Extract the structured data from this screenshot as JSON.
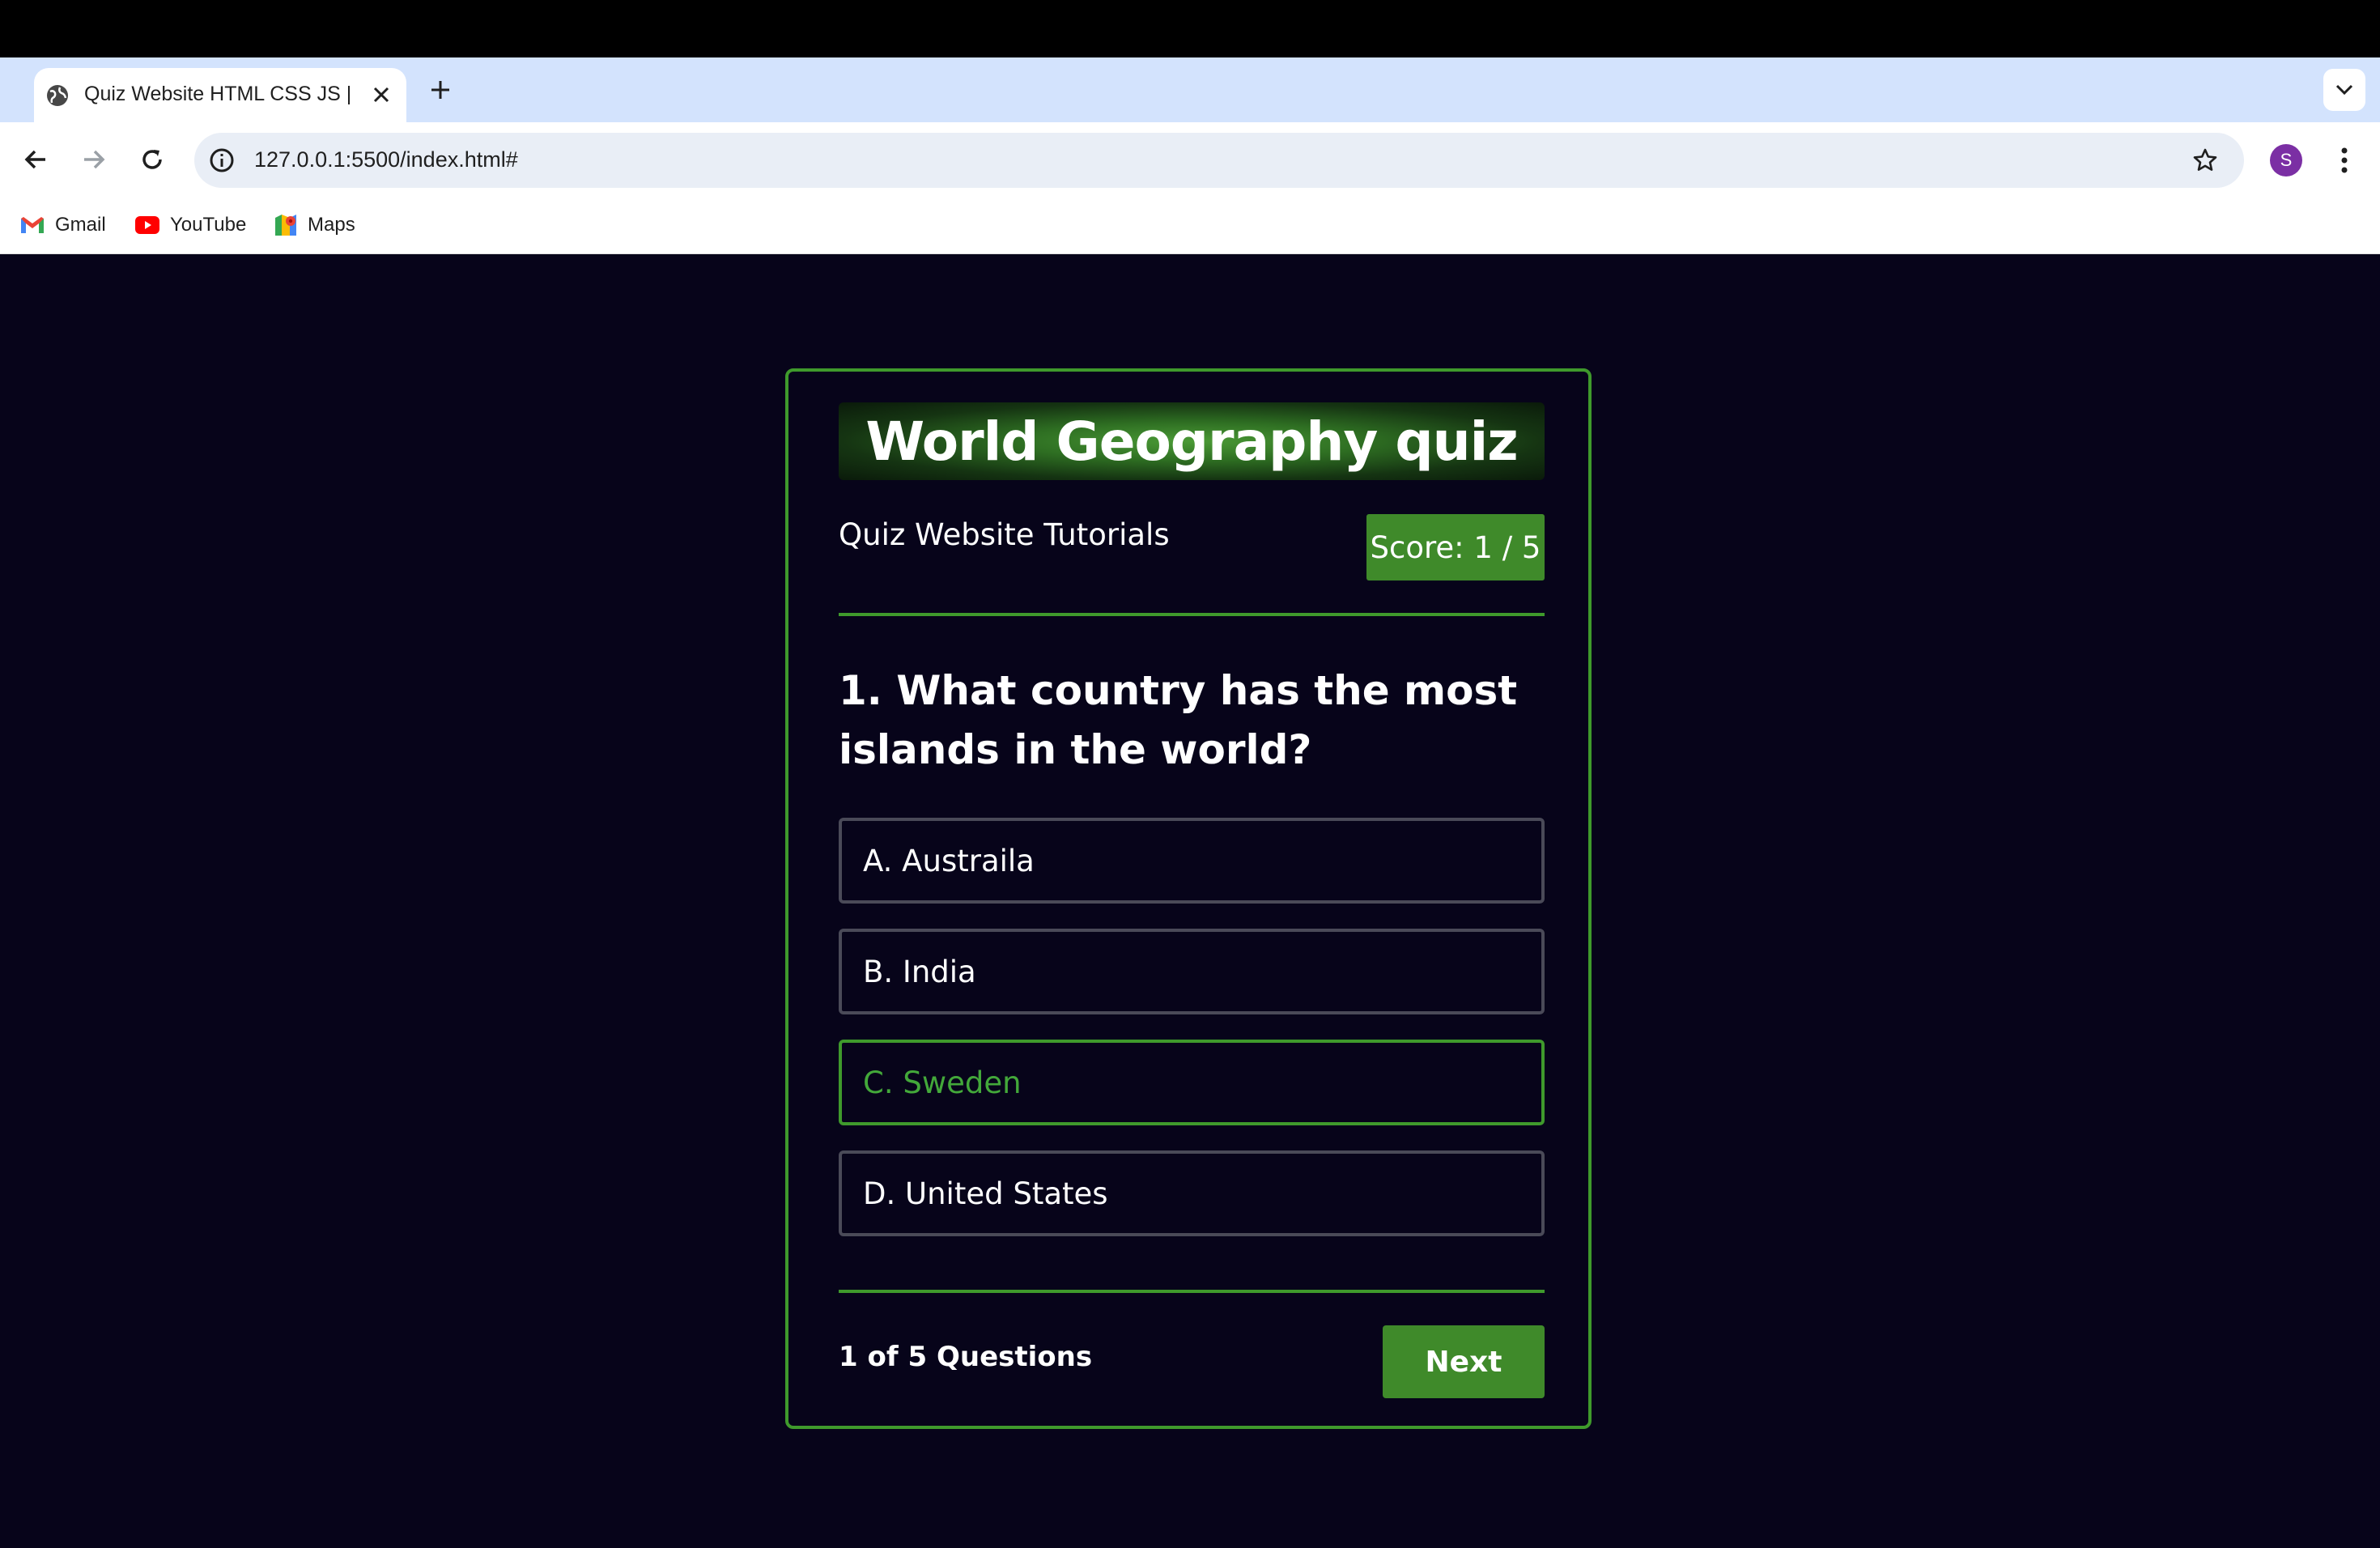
{
  "browser": {
    "tab": {
      "title": "Quiz Website HTML CSS JS |",
      "close_icon": "close-icon"
    },
    "new_tab_icon": "plus-icon",
    "tab_menu_icon": "chevron-down-icon",
    "nav": {
      "back_icon": "arrow-left-icon",
      "forward_icon": "arrow-right-icon",
      "reload_icon": "reload-icon"
    },
    "address_bar": {
      "url": "127.0.0.1:5500/index.html#",
      "info_icon": "info-icon",
      "bookmark_icon": "star-icon"
    },
    "profile": {
      "initial": "S",
      "color": "#7b2fa4"
    },
    "menu_icon": "kebab-menu-icon",
    "bookmarks": [
      {
        "label": "Gmail",
        "icon": "gmail-icon"
      },
      {
        "label": "YouTube",
        "icon": "youtube-icon"
      },
      {
        "label": "Maps",
        "icon": "maps-icon"
      }
    ]
  },
  "quiz": {
    "title": "World Geography quiz",
    "subtitle": "Quiz Website Tutorials",
    "score_label": "Score: 1 / 5",
    "question": "1. What country has the most islands in the world?",
    "options": [
      {
        "label": "A. Austraila",
        "state": "default"
      },
      {
        "label": "B. India",
        "state": "default"
      },
      {
        "label": "C. Sweden",
        "state": "correct"
      },
      {
        "label": "D. United States",
        "state": "default"
      }
    ],
    "progress": "1 of 5 Questions",
    "next_label": "Next"
  },
  "colors": {
    "page_background": "#07041a",
    "accent_green": "#3f8a2a",
    "correct_text": "#43a83a",
    "tab_strip": "#d3e3fd",
    "omnibox": "#e9eef6"
  }
}
